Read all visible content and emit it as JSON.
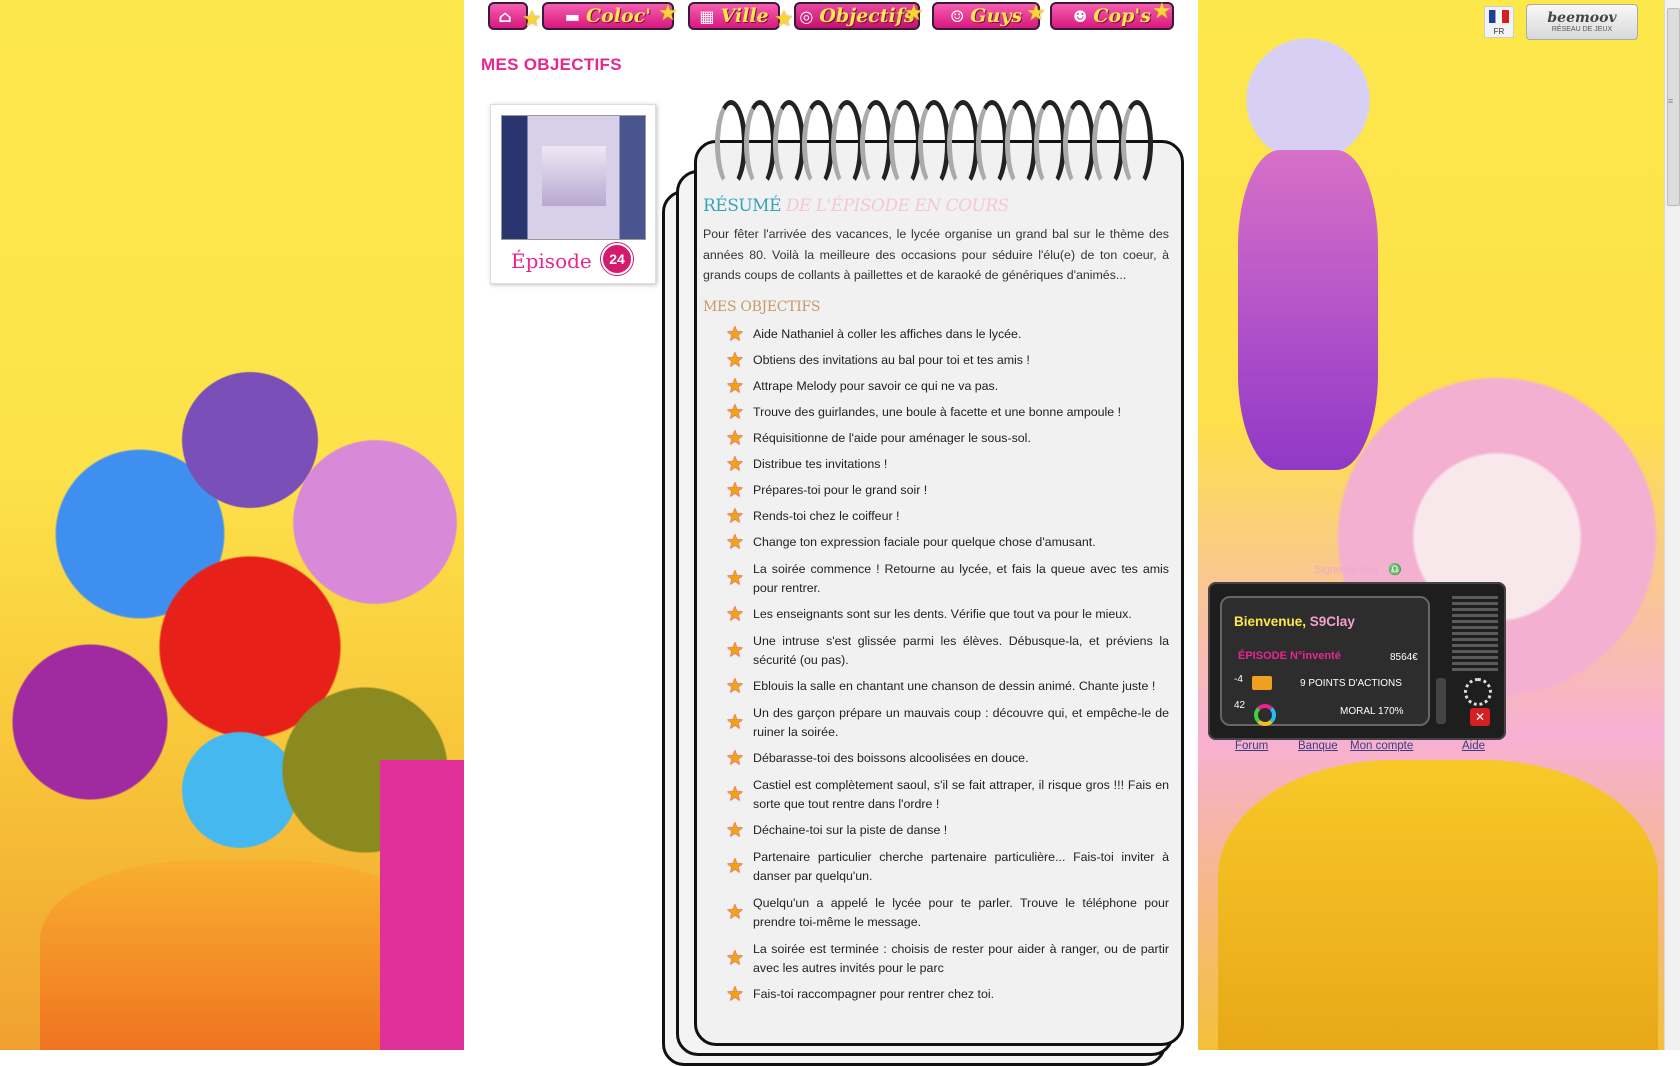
{
  "nav": {
    "items": [
      {
        "label": "",
        "icon": "home-icon"
      },
      {
        "label": "Coloc'",
        "icon": "sofa-icon"
      },
      {
        "label": "Ville",
        "icon": "building-icon"
      },
      {
        "label": "Objectifs",
        "icon": "target-icon"
      },
      {
        "label": "Guys",
        "icon": "guy-icon"
      },
      {
        "label": "Cop's",
        "icon": "girl-icon"
      }
    ]
  },
  "header": {
    "lang_code": "FR",
    "network_logo": "beemoov",
    "network_sub": "RÉSEAU DE JEUX"
  },
  "page_title": "MES OBJECTIFS",
  "episode": {
    "label": "Épisode",
    "number": "24"
  },
  "summary": {
    "title_part1": "RÉSUMÉ",
    "title_part2": " DE L'ÉPISODE EN COURS",
    "text": "Pour fêter l'arrivée des vacances, le lycée organise un grand bal sur le thème des années 80. Voilà la meilleure des occasions pour séduire l'élu(e) de ton coeur, à grands coups de collants à paillettes et de karaoké de génériques d'animés..."
  },
  "objectives": {
    "heading": "MES OBJECTIFS",
    "items": [
      "Aide Nathaniel à coller les affiches dans le lycée.",
      "Obtiens des invitations au bal pour toi et tes amis !",
      "Attrape Melody pour savoir ce qui ne va pas.",
      "Trouve des guirlandes, une boule à facette et une bonne ampoule !",
      "Réquisitionne de l'aide pour aménager le sous-sol.",
      "Distribue tes invitations !",
      "Prépares-toi pour le grand soir !",
      "Rends-toi chez le coiffeur !",
      "Change ton expression faciale pour quelque chose d'amusant.",
      "La soirée commence ! Retourne au lycée, et fais la queue avec tes amis pour rentrer.",
      "Les enseignants sont sur les dents. Vérifie que tout va pour le mieux.",
      "Une intruse s'est glissée parmi les élèves. Débusque-la, et préviens la sécurité (ou pas).",
      "Eblouis la salle en chantant une chanson de dessin animé. Chante juste !",
      "Un des garçon prépare un mauvais coup : découvre qui, et empêche-le de ruiner la soirée.",
      "Débarasse-toi des boissons alcoolisées en douce.",
      "Castiel est complètement saoul, s'il se fait attraper, il risque gros !!! Fais en sorte que tout rentre dans l'ordre !",
      "Déchaine-toi sur la piste de danse !",
      "Partenaire particulier cherche partenaire particulière... Fais-toi inviter à danser par quelqu'un.",
      "Quelqu'un a appelé le lycée pour te parler. Trouve le téléphone pour prendre toi-même le message.",
      "La soirée est terminée : choisis de rester pour aider à ranger, ou de partir avec les autres invités pour le parc",
      "Fais-toi raccompagner pour rentrer chez toi."
    ]
  },
  "widget": {
    "sign_text": "Signe du jour :",
    "welcome": "Bienvenue,",
    "username": "S9Clay",
    "episode_text": "ÉPISODE N°inventé",
    "money": "8564€",
    "mail_count": "-4",
    "action_points": "9 POINTS D'ACTIONS",
    "moral_count": "42",
    "moral": "MORAL 170%",
    "links": [
      "Forum",
      "Banque",
      "Mon compte",
      "Aide"
    ]
  },
  "colors": {
    "accent_pink": "#e8268f",
    "summary_teal": "#3aa3b8",
    "star_orange": "#f4a21a",
    "background_yellow": "#fde84b"
  }
}
